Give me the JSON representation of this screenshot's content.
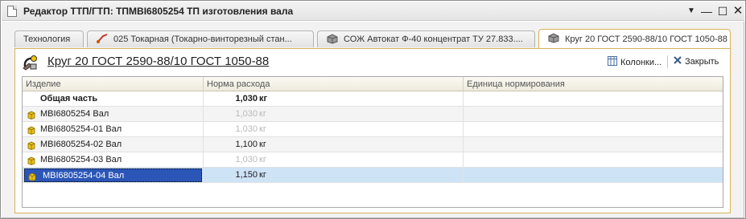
{
  "window": {
    "title": "Редактор ТТП/ГТП: ТПМВI6805254 ТП изготовления вала",
    "buttons": [
      "menu",
      "minimize",
      "maximize",
      "close"
    ]
  },
  "tabs": [
    {
      "label": "Технология",
      "icon": "none",
      "active": false
    },
    {
      "label": "025 Токарная (Токарно-винторезный стан...",
      "icon": "lathe-icon",
      "active": false
    },
    {
      "label": "СОЖ Автокат Ф-40 концентрат ТУ 27.833....",
      "icon": "material-icon",
      "active": false
    },
    {
      "label": "Круг 20 ГОСТ 2590-88/10 ГОСТ 1050-88",
      "icon": "material-icon",
      "active": true
    }
  ],
  "panel": {
    "title": "Круг 20 ГОСТ 2590-88/10 ГОСТ 1050-88",
    "columns_button": "Колонки...",
    "close_button": "Закрыть"
  },
  "table": {
    "headers": [
      "Изделие",
      "Норма расхода",
      "Единица нормирования"
    ],
    "rows": [
      {
        "name": "Общая часть",
        "qty": "1,030",
        "unit": "кг",
        "bold": true,
        "dim": false,
        "selected": false
      },
      {
        "name": "MBI6805254 Вал",
        "qty": "1,030",
        "unit": "кг",
        "bold": false,
        "dim": true,
        "selected": false
      },
      {
        "name": "MBI6805254-01 Вал",
        "qty": "1,030",
        "unit": "кг",
        "bold": false,
        "dim": true,
        "selected": false
      },
      {
        "name": "MBI6805254-02 Вал",
        "qty": "1,100",
        "unit": "кг",
        "bold": false,
        "dim": false,
        "selected": false
      },
      {
        "name": "MBI6805254-03 Вал",
        "qty": "1,030",
        "unit": "кг",
        "bold": false,
        "dim": true,
        "selected": false
      },
      {
        "name": "MBI6805254-04 Вал",
        "qty": "1,150",
        "unit": "кг",
        "bold": false,
        "dim": false,
        "selected": true
      }
    ]
  },
  "colors": {
    "active_tab_border": "#d7b35a",
    "selection_fill": "#2b56b8",
    "row_highlight": "#cfe3f7",
    "item_icon": "#e8c21c"
  }
}
